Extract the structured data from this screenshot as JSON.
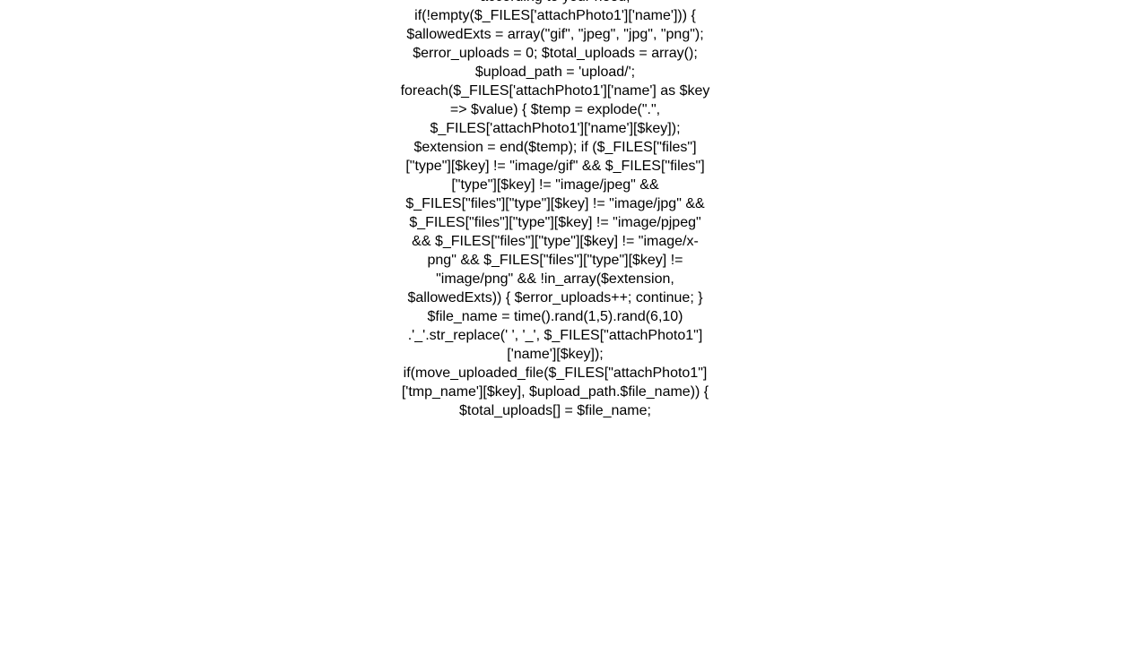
{
  "content": {
    "code_text": "according to your need; if(!empty($_FILES['attachPhoto1']['name'])) {         $allowedExts = array(\"gif\", \"jpeg\", \"jpg\", \"png\");         $error_uploads = 0;         $total_uploads = array();         $upload_path = 'upload/';         foreach($_FILES['attachPhoto1']['name'] as $key => $value) {             $temp = explode(\".\", $_FILES['attachPhoto1']['name'][$key]);             $extension = end($temp);             if ($_FILES[\"files\"][\"type\"][$key] != \"image/gif\"                     && $_FILES[\"files\"][\"type\"][$key] != \"image/jpeg\"                     && $_FILES[\"files\"][\"type\"][$key] != \"image/jpg\"                     && $_FILES[\"files\"][\"type\"][$key] != \"image/pjpeg\"                     && $_FILES[\"files\"][\"type\"][$key] != \"image/x-png\"                     && $_FILES[\"files\"][\"type\"][$key] != \"image/png\"                     && !in_array($extension, $allowedExts)) {                 $error_uploads++;                 continue;             }             $file_name = time().rand(1,5).rand(6,10) .'_'.str_replace(' ', '_', $_FILES[\"attachPhoto1\"]['name'][$key]);             if(move_uploaded_file($_FILES[\"attachPhoto1\"]['tmp_name'][$key], $upload_path.$file_name)) {                 $total_uploads[] = $file_name;"
  }
}
